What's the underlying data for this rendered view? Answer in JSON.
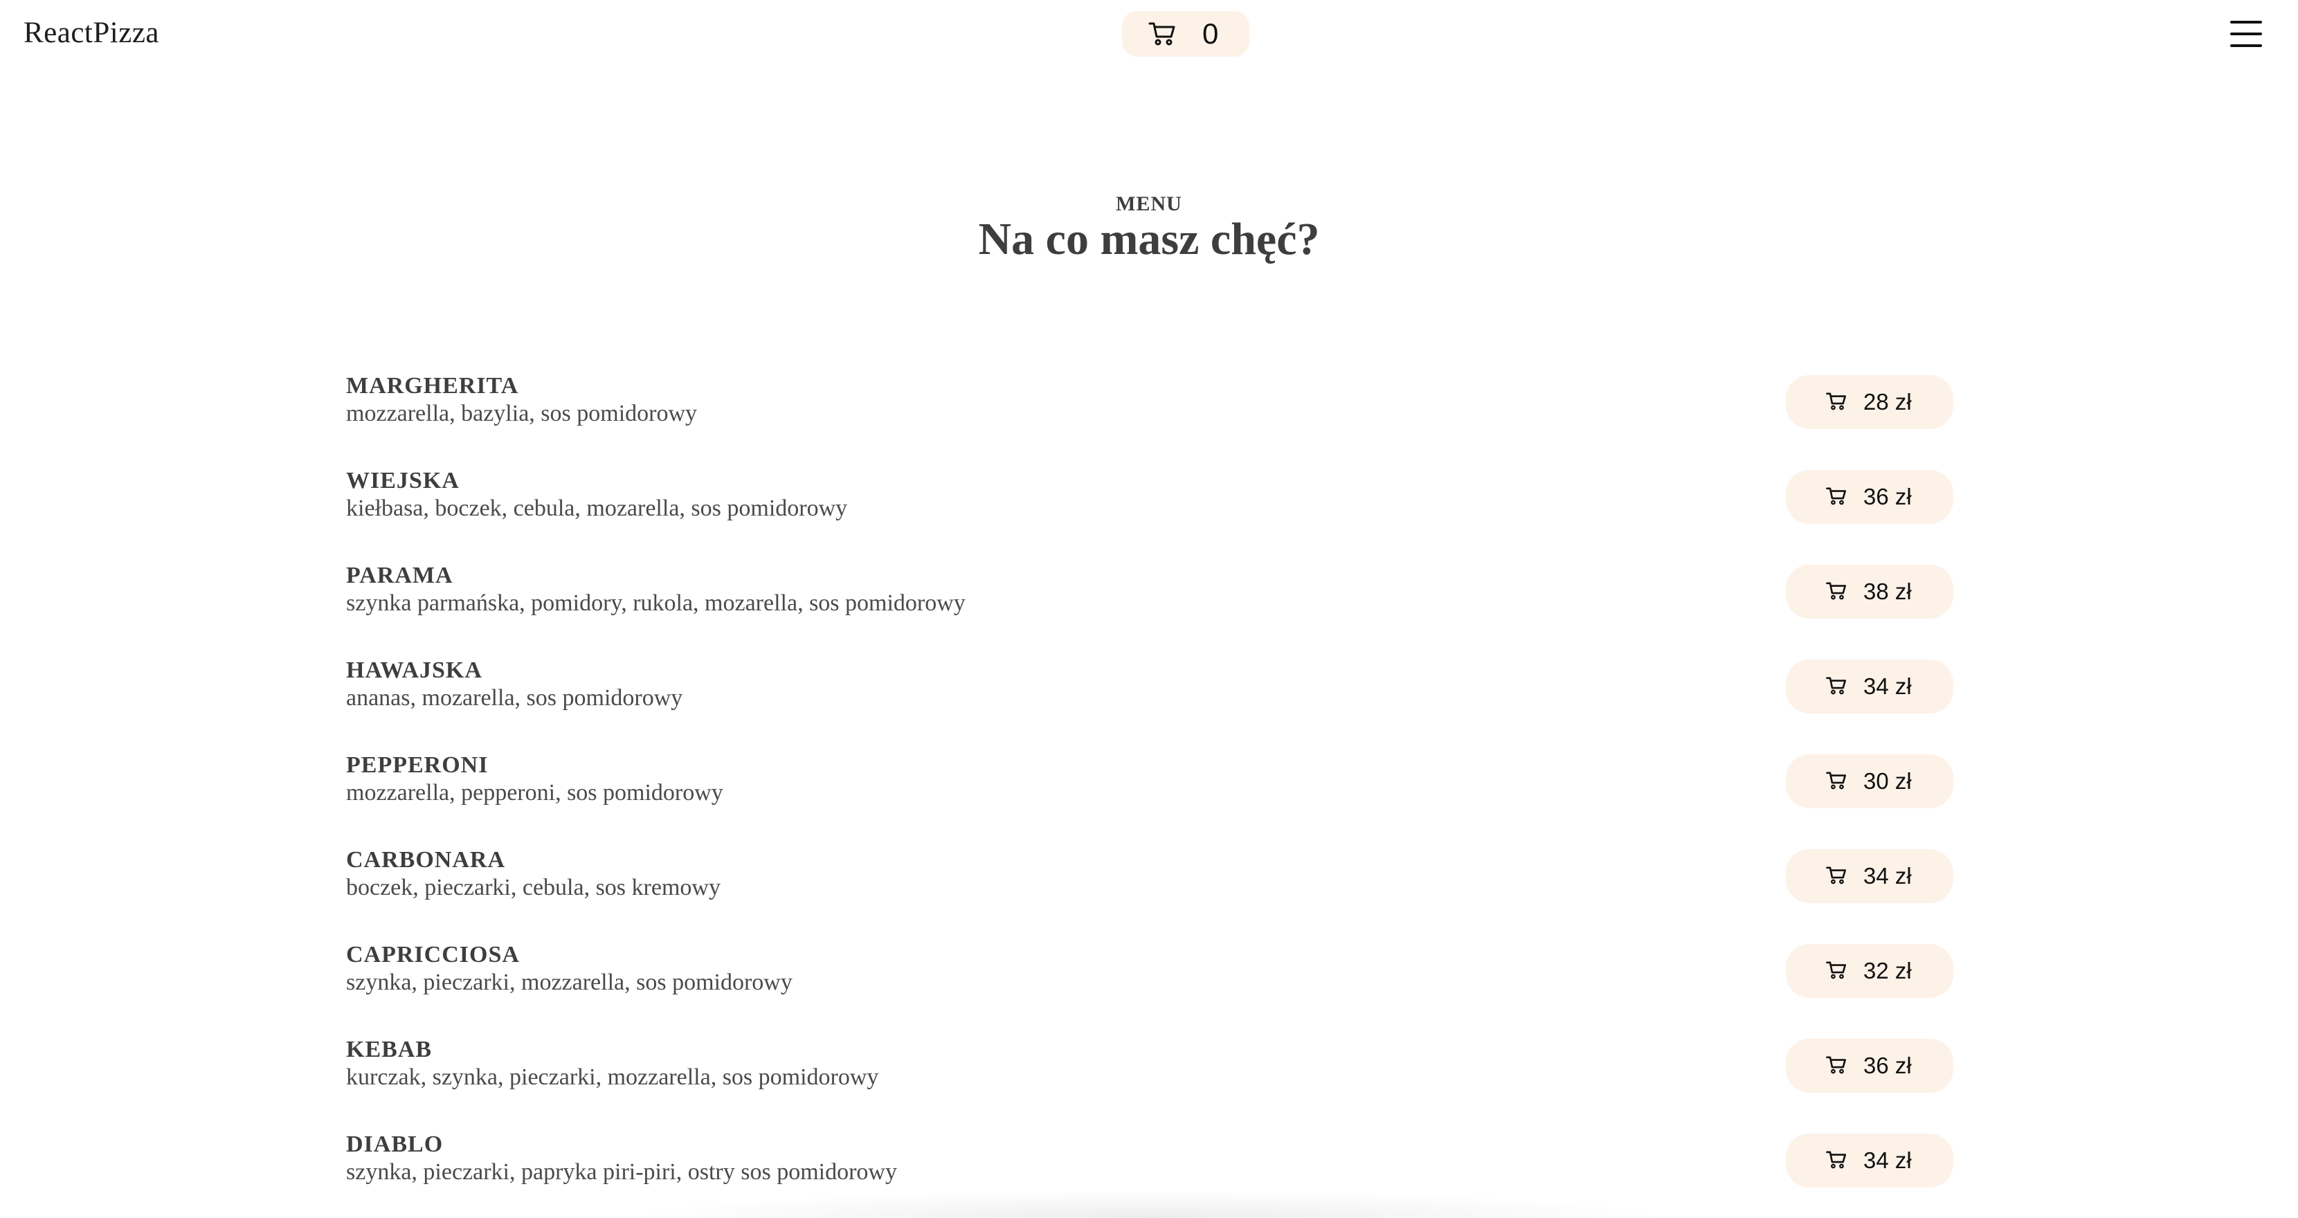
{
  "header": {
    "logo": "ReactPizza",
    "cart_count": "0",
    "cart_icon": "shopping-cart-icon",
    "menu_icon": "hamburger-menu-icon"
  },
  "menu": {
    "label": "MENU",
    "title": "Na co masz chęć?",
    "currency": "zł",
    "items": [
      {
        "name": "MARGHERITA",
        "desc": "mozzarella, bazylia, sos pomidorowy",
        "price": "28 zł"
      },
      {
        "name": "WIEJSKA",
        "desc": "kiełbasa, boczek, cebula, mozarella, sos pomidorowy",
        "price": "36 zł"
      },
      {
        "name": "PARAMA",
        "desc": "szynka parmańska, pomidory, rukola, mozarella, sos pomidorowy",
        "price": "38 zł"
      },
      {
        "name": "HAWAJSKA",
        "desc": "ananas, mozarella, sos pomidorowy",
        "price": "34 zł"
      },
      {
        "name": "PEPPERONI",
        "desc": "mozzarella, pepperoni, sos pomidorowy",
        "price": "30 zł"
      },
      {
        "name": "CARBONARA",
        "desc": "boczek, pieczarki, cebula, sos kremowy",
        "price": "34 zł"
      },
      {
        "name": "CAPRICCIOSA",
        "desc": "szynka, pieczarki, mozzarella, sos pomidorowy",
        "price": "32 zł"
      },
      {
        "name": "KEBAB",
        "desc": "kurczak, szynka, pieczarki, mozzarella, sos pomidorowy",
        "price": "36 zł"
      },
      {
        "name": "DIABLO",
        "desc": "szynka, pieczarki, papryka piri-piri, ostry sos pomidorowy",
        "price": "34 zł"
      }
    ]
  },
  "colors": {
    "pill_background": "#fdf2e8",
    "text": "#3e3e3e"
  }
}
